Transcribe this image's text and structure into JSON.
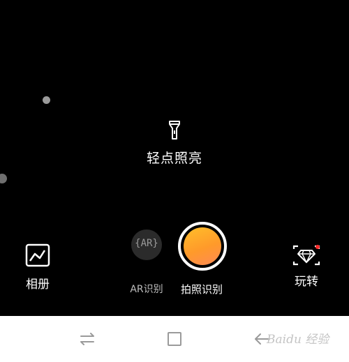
{
  "camera": {
    "flash_hint": "轻点照亮"
  },
  "controls": {
    "album_label": "相册",
    "ar_icon_text": "{AR}",
    "ar_label": "AR识别",
    "shutter_label": "拍照识别",
    "play_label": "玩转"
  },
  "colors": {
    "shutter_gradient_start": "#ffbe2a",
    "shutter_gradient_end": "#ff8a55",
    "notification_dot": "#ff2a2a"
  },
  "navbar": {
    "icons": [
      "recent-apps-icon",
      "home-icon",
      "back-icon"
    ]
  },
  "watermark": {
    "text": "Baidu 经验"
  }
}
